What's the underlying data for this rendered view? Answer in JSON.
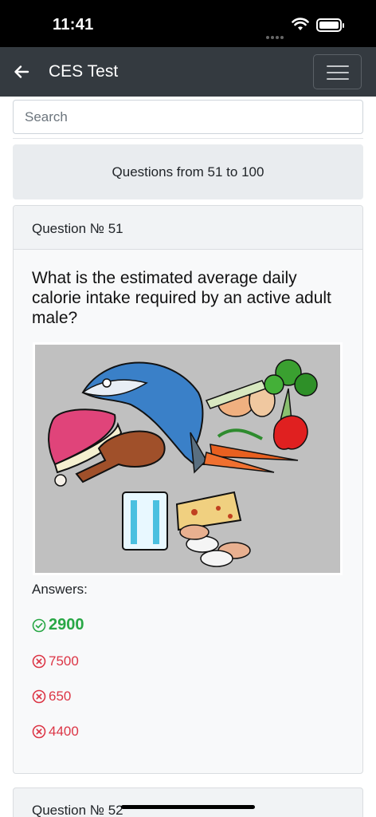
{
  "status_bar": {
    "time": "11:41"
  },
  "navbar": {
    "title": "CES Test",
    "back_icon": "arrow-left-icon",
    "menu_icon": "hamburger-icon"
  },
  "search": {
    "placeholder": "Search",
    "value": ""
  },
  "range": {
    "label": "Questions from 51 to 100"
  },
  "question_card": {
    "header": "Question № 51",
    "question": "What is the estimated average daily calorie intake required by an active adult male?",
    "image": "food-groups-illustration",
    "answers_label": "Answers:",
    "answers": [
      {
        "text": "2900",
        "correct": true,
        "icon": "check-circle-icon"
      },
      {
        "text": "7500",
        "correct": false,
        "icon": "x-circle-icon"
      },
      {
        "text": "650",
        "correct": false,
        "icon": "x-circle-icon"
      },
      {
        "text": "4400",
        "correct": false,
        "icon": "x-circle-icon"
      }
    ]
  },
  "next_card": {
    "header": "Question № 52"
  },
  "colors": {
    "navbar": "#343a40",
    "correct": "#28a745",
    "wrong": "#dc3545",
    "card_bg": "#f8f9fa"
  }
}
